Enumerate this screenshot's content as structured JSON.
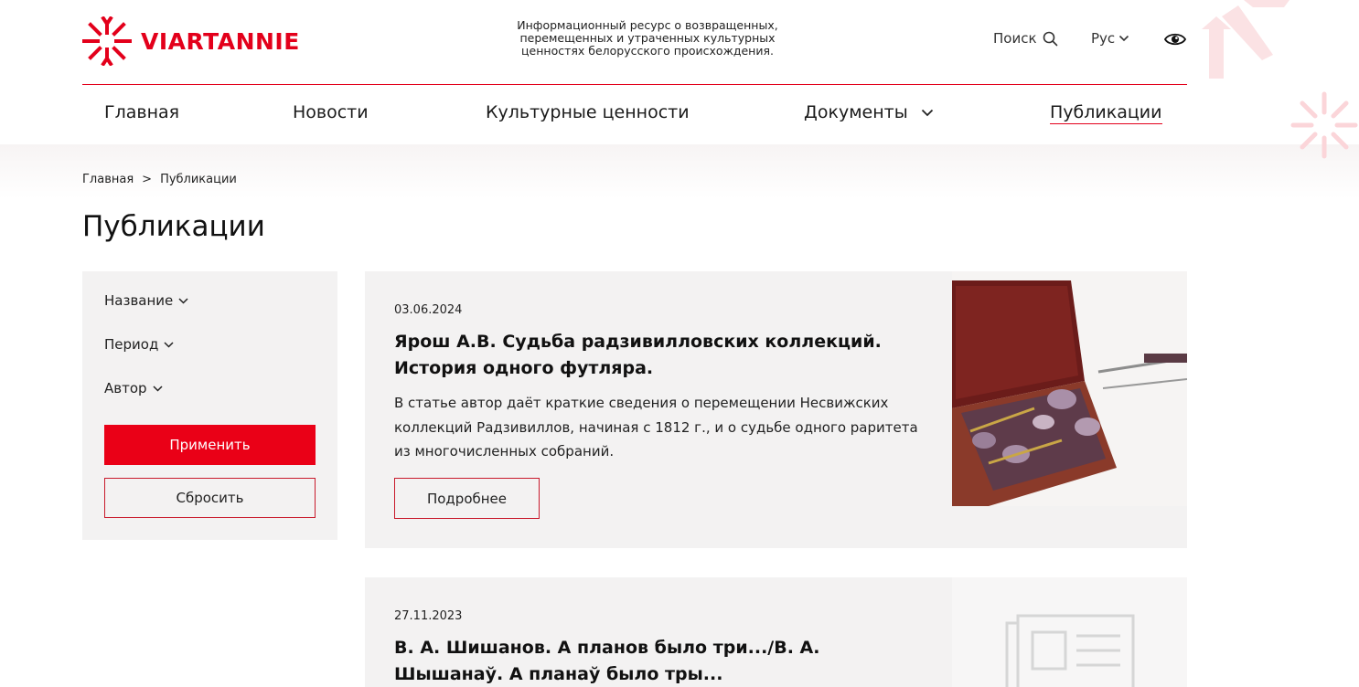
{
  "colors": {
    "accent": "#e3001b",
    "panel": "#f3f2f2"
  },
  "brand": {
    "name": "VIARTANNIE",
    "tagline": "Информационный ресурс о возвращенных, перемещенных и утраченных культурных ценностях белорусского происхождения."
  },
  "header": {
    "search_label": "Поиск",
    "lang_label": "Рус",
    "search_icon": "search-icon",
    "accessibility_icon": "eye-icon"
  },
  "nav": [
    {
      "label": "Главная"
    },
    {
      "label": "Новости"
    },
    {
      "label": "Культурные ценности"
    },
    {
      "label": "Документы"
    },
    {
      "label": "Публикации"
    }
  ],
  "breadcrumb": {
    "home": "Главная",
    "separator": ">",
    "current": "Публикации"
  },
  "page_title": "Публикации",
  "filters": {
    "items": [
      {
        "label": "Название"
      },
      {
        "label": "Период"
      },
      {
        "label": "Автор"
      }
    ],
    "apply_label": "Применить",
    "reset_label": "Сбросить"
  },
  "publications": [
    {
      "date": "03.06.2024",
      "title": "Ярош А.В. Судьба радзивилловских коллекций. История одного футляра.",
      "description": "В статье автор даёт краткие сведения о перемещении Несвижских коллекций Радзивиллов, начиная с 1812 г., и о судьбе одного раритета из многочисленных собраний.",
      "more_label": "Подробнее"
    },
    {
      "date": "27.11.2023",
      "title": "В. А. Шишанов. А планов было три.../В. А. Шышанаў. А планаў было тры..."
    }
  ]
}
